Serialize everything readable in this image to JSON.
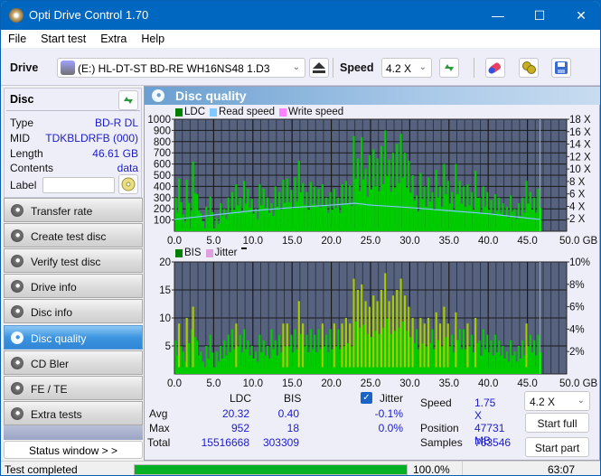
{
  "window": {
    "title": "Opti Drive Control 1.70",
    "controls": {
      "minimize": "—",
      "maximize": "☐",
      "close": "✕"
    }
  },
  "menu": [
    "File",
    "Start test",
    "Extra",
    "Help"
  ],
  "toolbar": {
    "drive_label": "Drive",
    "drive_value": "(E:)  HL-DT-ST BD-RE  WH16NS48 1.D3",
    "speed_label": "Speed",
    "speed_value": "4.2 X",
    "icons": [
      "eject-icon",
      "refresh-icon",
      "erase-icon",
      "settings-icon",
      "save-icon"
    ]
  },
  "disc": {
    "header": "Disc",
    "type_label": "Type",
    "type_value": "BD-R DL",
    "mid_label": "MID",
    "mid_value": "TDKBLDRFB (000)",
    "length_label": "Length",
    "length_value": "46.61 GB",
    "contents_label": "Contents",
    "contents_value": "data",
    "label_label": "Label",
    "label_value": ""
  },
  "nav": [
    {
      "label": "Transfer rate",
      "active": false
    },
    {
      "label": "Create test disc",
      "active": false
    },
    {
      "label": "Verify test disc",
      "active": false
    },
    {
      "label": "Drive info",
      "active": false
    },
    {
      "label": "Disc info",
      "active": false
    },
    {
      "label": "Disc quality",
      "active": true
    },
    {
      "label": "CD Bler",
      "active": false
    },
    {
      "label": "FE / TE",
      "active": false
    },
    {
      "label": "Extra tests",
      "active": false
    }
  ],
  "status_window_button": "Status window > >",
  "main": {
    "title": "Disc quality"
  },
  "colors": {
    "ldc": "#008000",
    "read_speed": "#80c8ff",
    "write_speed": "#ff80ff",
    "bis": "#008000",
    "jitter": "#e0a0e0",
    "plot_bg": "#56627e",
    "bar_green": "#00cc00",
    "bar_yellow": "#aacc00",
    "progress": "#06b025"
  },
  "chart_data": [
    {
      "type": "bar",
      "title": "LDC",
      "legend": [
        "LDC",
        "Read speed",
        "Write speed"
      ],
      "legend_position": "top-left",
      "x_ticks": [
        "0.0",
        "5.0",
        "10.0",
        "15.0",
        "20.0",
        "25.0",
        "30.0",
        "35.0",
        "40.0",
        "45.0",
        "50.0 GB"
      ],
      "xlim": [
        0,
        50
      ],
      "y_ticks": [
        "1000",
        "900",
        "800",
        "700",
        "600",
        "500",
        "400",
        "300",
        "200",
        "100"
      ],
      "ylim": [
        0,
        1000
      ],
      "y2_ticks": [
        "18 X",
        "16 X",
        "14 X",
        "12 X",
        "10 X",
        "8 X",
        "6 X",
        "4 X",
        "2 X"
      ],
      "y2lim": [
        0,
        18
      ],
      "grid": true,
      "ldc_peaks_x": [
        0.3,
        0.7,
        1.3,
        1.7,
        2.3,
        2.5,
        3.0,
        3.5,
        4.2,
        4.7,
        5.5,
        6.0,
        6.5,
        7.0,
        7.5,
        8.0,
        8.5,
        9.0,
        9.5,
        10.0,
        10.5,
        11.0,
        11.5,
        12.0,
        12.5,
        13.0,
        13.5,
        14.0,
        14.5,
        15.0,
        15.5,
        16.0,
        16.5,
        17.0,
        17.5,
        18.0,
        18.5,
        19.0,
        19.5,
        20.0,
        20.5,
        21.0,
        21.5,
        22.0,
        22.5,
        23.0,
        23.5,
        24.0,
        24.5,
        25.0,
        25.5,
        26.0,
        26.5,
        27.0,
        27.5,
        28.0,
        28.5,
        29.0,
        29.5,
        30.0,
        30.5,
        31.0,
        31.5,
        32.0,
        32.5,
        33.0,
        33.5,
        34.0,
        34.5,
        35.0,
        35.5,
        36.0,
        36.5,
        37.0,
        37.5,
        38.0,
        38.5,
        39.0,
        39.5,
        40.0,
        40.5,
        41.0,
        41.5,
        42.0,
        42.5,
        43.0,
        43.5,
        44.0,
        44.5,
        45.0,
        45.5,
        46.0,
        46.5
      ],
      "ldc_peaks_y": [
        300,
        470,
        150,
        460,
        180,
        620,
        330,
        160,
        220,
        310,
        120,
        250,
        200,
        300,
        350,
        420,
        300,
        450,
        380,
        290,
        200,
        420,
        380,
        300,
        250,
        400,
        350,
        460,
        470,
        370,
        480,
        630,
        430,
        350,
        440,
        400,
        380,
        420,
        300,
        350,
        380,
        300,
        420,
        450,
        410,
        850,
        650,
        840,
        560,
        680,
        730,
        650,
        760,
        900,
        640,
        700,
        780,
        870,
        700,
        630,
        500,
        320,
        520,
        400,
        480,
        350,
        550,
        400,
        600,
        450,
        350,
        600,
        450,
        400,
        420,
        350,
        540,
        300,
        400,
        350,
        280,
        330,
        300,
        250,
        220,
        320,
        200,
        250,
        300,
        450,
        350,
        300,
        380,
        200
      ],
      "read_speed_x": [
        0,
        5,
        10,
        15,
        20,
        23,
        25,
        30,
        35,
        40,
        45,
        46.6
      ],
      "read_speed_y": [
        1.9,
        2.6,
        3.3,
        3.8,
        4.2,
        4.5,
        4.2,
        3.8,
        3.3,
        2.8,
        2.1,
        1.9
      ],
      "end_marker_x": 46.6
    },
    {
      "type": "bar",
      "title": "BIS",
      "legend": [
        "BIS",
        "Jitter"
      ],
      "legend_position": "top-left",
      "x_ticks": [
        "0.0",
        "5.0",
        "10.0",
        "15.0",
        "20.0",
        "25.0",
        "30.0",
        "35.0",
        "40.0",
        "45.0",
        "50.0 GB"
      ],
      "xlim": [
        0,
        50
      ],
      "y_ticks": [
        "20",
        "15",
        "10",
        "5"
      ],
      "ylim": [
        0,
        20
      ],
      "y2_ticks": [
        "10%",
        "8%",
        "6%",
        "4%",
        "2%"
      ],
      "y2lim": [
        0,
        10
      ],
      "grid": true,
      "bis_peaks_x": [
        0.3,
        0.7,
        1.3,
        1.7,
        2.3,
        2.5,
        3.0,
        3.5,
        4.2,
        4.7,
        5.5,
        6.0,
        6.5,
        7.0,
        7.5,
        8.0,
        8.5,
        9.0,
        9.5,
        10.0,
        10.5,
        11.0,
        11.5,
        12.0,
        12.5,
        13.0,
        13.5,
        14.0,
        14.5,
        15.0,
        15.5,
        16.0,
        16.5,
        17.0,
        17.5,
        18.0,
        18.5,
        19.0,
        19.5,
        20.0,
        20.5,
        21.0,
        21.5,
        22.0,
        22.5,
        23.0,
        23.5,
        24.0,
        24.5,
        25.0,
        25.5,
        26.0,
        26.5,
        27.0,
        27.5,
        28.0,
        28.5,
        29.0,
        29.5,
        30.0,
        30.5,
        31.0,
        31.5,
        32.0,
        32.5,
        33.0,
        33.5,
        34.0,
        34.5,
        35.0,
        35.5,
        36.0,
        36.5,
        37.0,
        37.5,
        38.0,
        38.5,
        39.0,
        39.5,
        40.0,
        40.5,
        41.0,
        41.5,
        42.0,
        42.5,
        43.0,
        43.5,
        44.0,
        44.5,
        45.0,
        45.5,
        46.0,
        46.5
      ],
      "bis_peaks_y": [
        6,
        9,
        4,
        10,
        8,
        12,
        6,
        4,
        5,
        7,
        4,
        5,
        6,
        7,
        8,
        9,
        7,
        8,
        6,
        5,
        4,
        7,
        6,
        5,
        8,
        6,
        7,
        9,
        9,
        7,
        8,
        13,
        9,
        7,
        8,
        7,
        8,
        9,
        7,
        8,
        9,
        8,
        9,
        10,
        9,
        17,
        15,
        16,
        13,
        12,
        14,
        13,
        15,
        18,
        13,
        14,
        15,
        17,
        14,
        12,
        10,
        8,
        10,
        9,
        10,
        8,
        11,
        9,
        12,
        9,
        7,
        11,
        8,
        8,
        9,
        7,
        10,
        6,
        8,
        7,
        6,
        7,
        6,
        5,
        4,
        6,
        4,
        5,
        6,
        9,
        7,
        6,
        7,
        4
      ],
      "end_marker_x": 46.6
    }
  ],
  "stats": {
    "col_ldc": "LDC",
    "col_bis": "BIS",
    "avg_label": "Avg",
    "max_label": "Max",
    "total_label": "Total",
    "avg_ldc": "20.32",
    "avg_bis": "0.40",
    "max_ldc": "952",
    "max_bis": "18",
    "total_ldc": "15516668",
    "total_bis": "303309",
    "jitter_label": "Jitter",
    "jitter_checked": true,
    "jitter_avg": "-0.1%",
    "jitter_max": "0.0%",
    "speed_label": "Speed",
    "speed_value": "1.75 X",
    "position_label": "Position",
    "position_value": "47731 MB",
    "samples_label": "Samples",
    "samples_value": "763546",
    "speed_select": "4.2 X",
    "start_full": "Start full",
    "start_part": "Start part"
  },
  "statusbar": {
    "text": "Test completed",
    "progress_percent": 100.0,
    "progress_label": "100.0%",
    "time": "63:07"
  }
}
